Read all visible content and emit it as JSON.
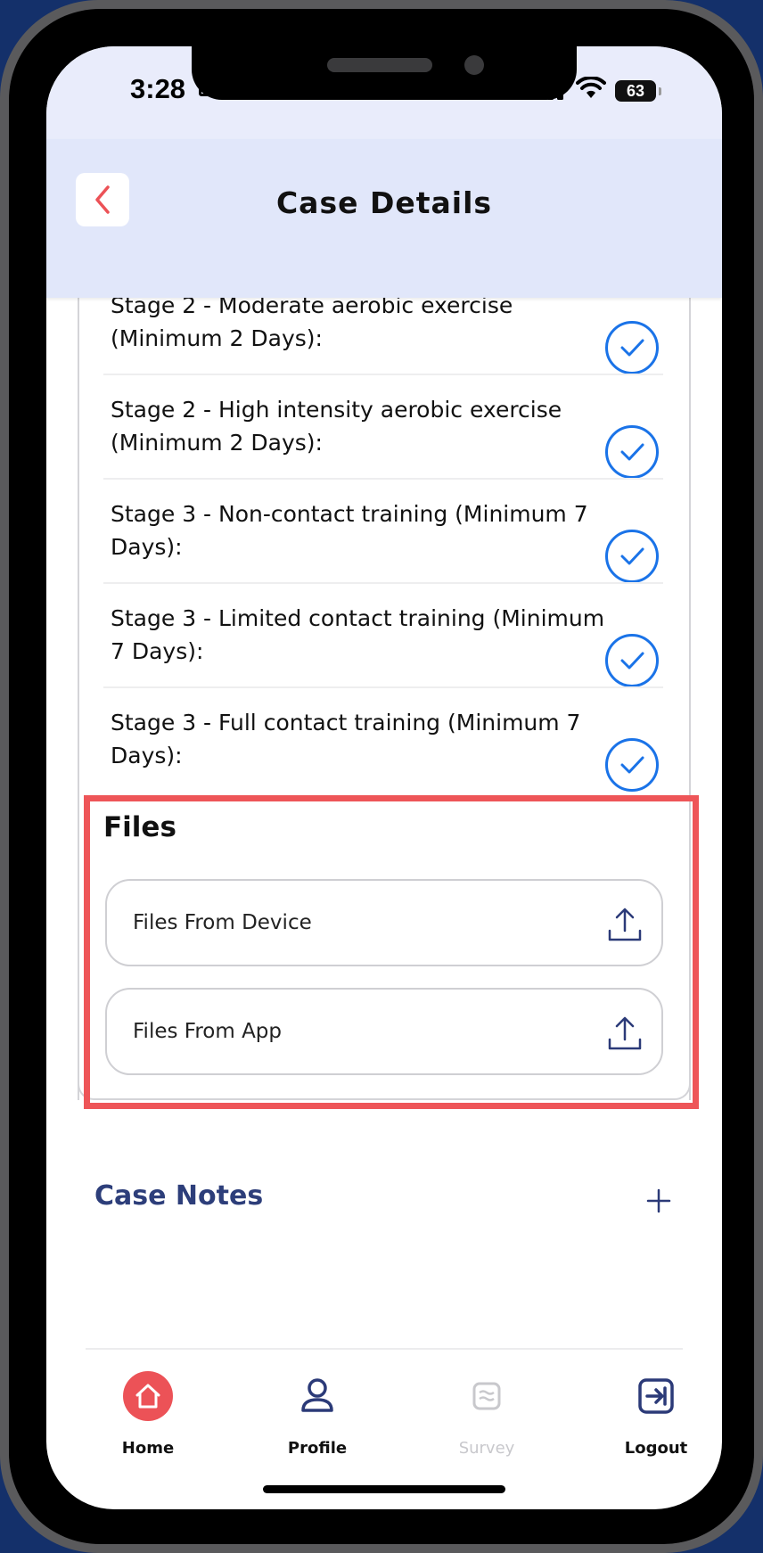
{
  "status_bar": {
    "time": "3:28",
    "battery": "63"
  },
  "header": {
    "title": "Case Details"
  },
  "stages": [
    {
      "label": "Stage 2 - Moderate aerobic exercise (Minimum 2 Days):",
      "completed": true
    },
    {
      "label": "Stage 2 - High intensity aerobic exercise (Minimum 2 Days):",
      "completed": true
    },
    {
      "label": "Stage 3 - Non-contact training (Minimum 7 Days):",
      "completed": true
    },
    {
      "label": "Stage 3 - Limited contact training (Minimum 7 Days):",
      "completed": true
    },
    {
      "label": "Stage 3 - Full contact training (Minimum 7 Days):",
      "completed": true
    }
  ],
  "files": {
    "title": "Files",
    "from_device": "Files From Device",
    "from_app": "Files From App"
  },
  "case_notes": {
    "title": "Case Notes"
  },
  "tabbar": {
    "home": "Home",
    "profile": "Profile",
    "survey": "Survey",
    "logout": "Logout"
  },
  "colors": {
    "accent_blue": "#1a73e8",
    "header_bg": "#e1e7fa",
    "case_notes_text": "#2d3e7a",
    "highlight_red": "#ee5558",
    "home_red": "#ec5257",
    "nav_blue": "#2b3a78"
  }
}
